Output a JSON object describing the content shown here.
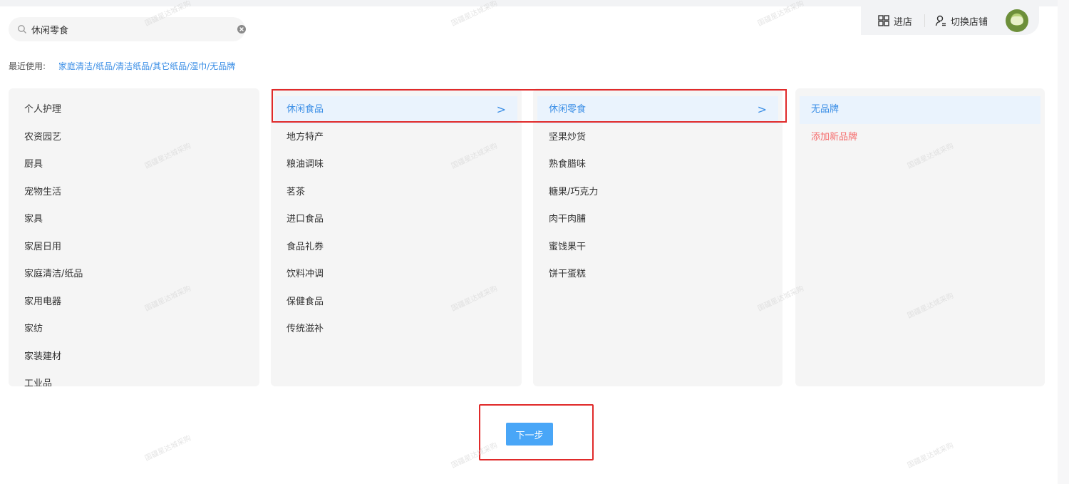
{
  "search": {
    "value": "休闲零食",
    "icon": "search-icon",
    "clear_icon": "clear-icon"
  },
  "topbar": {
    "store_label": "进店",
    "switch_label": "切换店铺",
    "store_icon": "grid-icon",
    "switch_icon": "user-switch-icon"
  },
  "recent": {
    "label": "最近使用:",
    "link": "家庭清洁/纸品/清洁纸品/其它纸品/湿巾/无品牌"
  },
  "columns": {
    "level1": [
      "个人护理",
      "农资园艺",
      "厨具",
      "宠物生活",
      "家具",
      "家居日用",
      "家庭清洁/纸品",
      "家用电器",
      "家纺",
      "家装建材",
      "工业品"
    ],
    "level2": [
      "休闲食品",
      "地方特产",
      "粮油调味",
      "茗茶",
      "进口食品",
      "食品礼券",
      "饮料冲调",
      "保健食品",
      "传统滋补"
    ],
    "level3": [
      "休闲零食",
      "坚果炒货",
      "熟食腊味",
      "糖果/巧克力",
      "肉干肉脯",
      "蜜饯果干",
      "饼干蛋糕"
    ],
    "brands": [
      "无品牌"
    ],
    "add_brand": "添加新品牌",
    "selected_level2": "休闲食品",
    "selected_level3": "休闲零食",
    "selected_brand": "无品牌",
    "chevron": ">"
  },
  "actions": {
    "next_label": "下一步"
  },
  "colors": {
    "accent": "#3a8ee6",
    "highlight_border": "#e02a2a",
    "add_brand": "#f56c6c",
    "button": "#49a6f7"
  }
}
